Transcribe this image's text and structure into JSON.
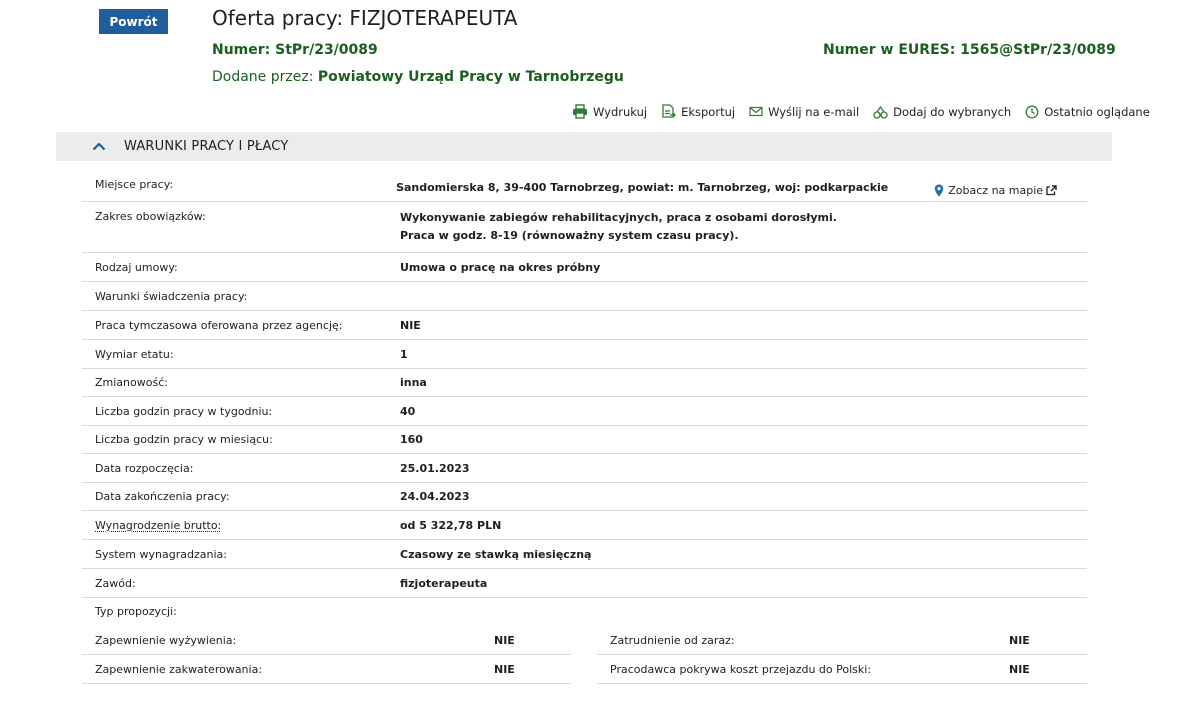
{
  "header": {
    "back_label": "Powrót",
    "title": "Oferta pracy: FIZJOTERAPEUTA",
    "number": "Numer: StPr/23/0089",
    "eures": "Numer w EURES: 1565@StPr/23/0089",
    "added_prefix": "Dodane przez: ",
    "added_by": "Powiatowy Urząd Pracy w Tarnobrzegu"
  },
  "toolbar": {
    "print": "Wydrukuj",
    "export": "Eksportuj",
    "email": "Wyślij na e-mail",
    "favorite": "Dodaj do wybranych",
    "recent": "Ostatnio oglądane"
  },
  "section": {
    "title": "WARUNKI PRACY I PŁACY"
  },
  "rows": {
    "location": {
      "label": "Miejsce pracy:",
      "value": "Sandomierska 8, 39-400 Tarnobrzeg, powiat: m. Tarnobrzeg, woj: podkarpackie",
      "map": "Zobacz na mapie"
    },
    "duties": {
      "label": "Zakres obowiązków:",
      "line1": "Wykonywanie zabiegów rehabilitacyjnych, praca z osobami dorosłymi.",
      "line2": "Praca w godz. 8-19 (równoważny system czasu pracy)."
    },
    "contract": {
      "label": "Rodzaj umowy:",
      "value": "Umowa o pracę na okres próbny"
    },
    "conditions": {
      "label": "Warunki świadczenia pracy:",
      "value": ""
    },
    "temp": {
      "label": "Praca tymczasowa oferowana przez agencję:",
      "value": "NIE"
    },
    "fte": {
      "label": "Wymiar etatu:",
      "value": "1"
    },
    "shifts": {
      "label": "Zmianowość:",
      "value": "inna"
    },
    "hours_week": {
      "label": "Liczba godzin pracy w tygodniu:",
      "value": "40"
    },
    "hours_month": {
      "label": "Liczba godzin pracy w miesiącu:",
      "value": "160"
    },
    "start": {
      "label": "Data rozpoczęcia:",
      "value": "25.01.2023"
    },
    "end": {
      "label": "Data zakończenia pracy:",
      "value": "24.04.2023"
    },
    "salary": {
      "label": "Wynagrodzenie brutto:",
      "value": "od 5 322,78 PLN"
    },
    "pay_system": {
      "label": "System wynagradzania:",
      "value": "Czasowy ze stawką miesięczną"
    },
    "profession": {
      "label": "Zawód:",
      "value": "fizjoterapeuta"
    }
  },
  "proposals": {
    "title": "Typ propozycji:",
    "food_label": "Zapewnienie wyżywienia:",
    "food_value": "NIE",
    "housing_label": "Zapewnienie zakwaterowania:",
    "housing_value": "NIE",
    "immediate_label": "Zatrudnienie od zaraz:",
    "immediate_value": "NIE",
    "travel_label": "Pracodawca pokrywa koszt przejazdu do Polski:",
    "travel_value": "NIE"
  },
  "colors": {
    "primary": "#1f5d9b",
    "green": "#1b5e20",
    "icon_green": "#2e7d32",
    "map_pin": "#1f6fa8",
    "section_bg": "#ececec"
  }
}
